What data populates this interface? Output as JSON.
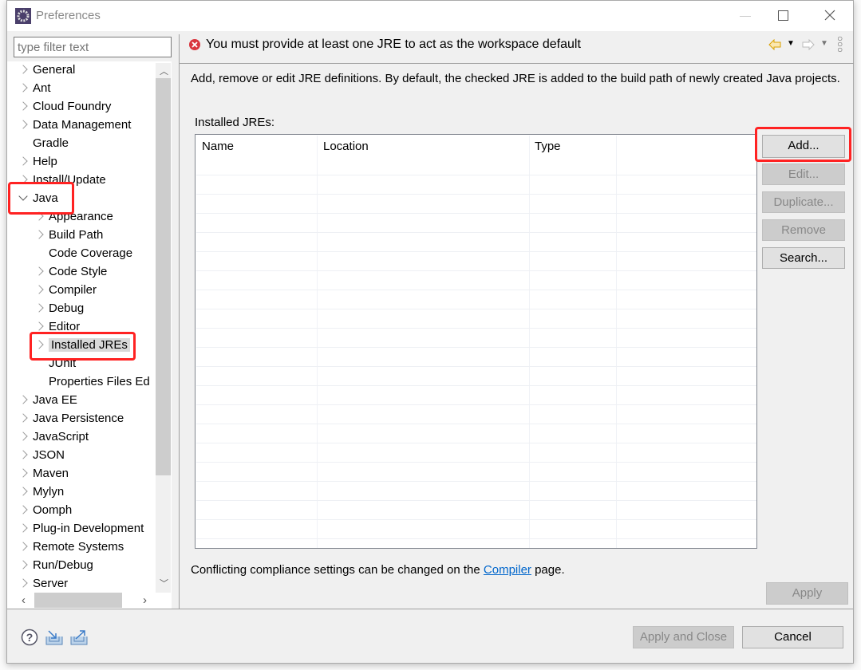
{
  "window": {
    "title": "Preferences"
  },
  "filter": {
    "placeholder": "type filter text"
  },
  "tree": [
    {
      "label": "General",
      "level": 0,
      "arrow": "right"
    },
    {
      "label": "Ant",
      "level": 0,
      "arrow": "right"
    },
    {
      "label": "Cloud Foundry",
      "level": 0,
      "arrow": "right"
    },
    {
      "label": "Data Management",
      "level": 0,
      "arrow": "right"
    },
    {
      "label": "Gradle",
      "level": 0,
      "arrow": "none"
    },
    {
      "label": "Help",
      "level": 0,
      "arrow": "right"
    },
    {
      "label": "Install/Update",
      "level": 0,
      "arrow": "right"
    },
    {
      "label": "Java",
      "level": 0,
      "arrow": "down"
    },
    {
      "label": "Appearance",
      "level": 1,
      "arrow": "right"
    },
    {
      "label": "Build Path",
      "level": 1,
      "arrow": "right"
    },
    {
      "label": "Code Coverage",
      "level": 1,
      "arrow": "none"
    },
    {
      "label": "Code Style",
      "level": 1,
      "arrow": "right"
    },
    {
      "label": "Compiler",
      "level": 1,
      "arrow": "right"
    },
    {
      "label": "Debug",
      "level": 1,
      "arrow": "right"
    },
    {
      "label": "Editor",
      "level": 1,
      "arrow": "right"
    },
    {
      "label": "Installed JREs",
      "level": 1,
      "arrow": "right",
      "selected": true
    },
    {
      "label": "JUnit",
      "level": 1,
      "arrow": "none"
    },
    {
      "label": "Properties Files Ed",
      "level": 1,
      "arrow": "none"
    },
    {
      "label": "Java EE",
      "level": 0,
      "arrow": "right"
    },
    {
      "label": "Java Persistence",
      "level": 0,
      "arrow": "right"
    },
    {
      "label": "JavaScript",
      "level": 0,
      "arrow": "right"
    },
    {
      "label": "JSON",
      "level": 0,
      "arrow": "right"
    },
    {
      "label": "Maven",
      "level": 0,
      "arrow": "right"
    },
    {
      "label": "Mylyn",
      "level": 0,
      "arrow": "right"
    },
    {
      "label": "Oomph",
      "level": 0,
      "arrow": "right"
    },
    {
      "label": "Plug-in Development",
      "level": 0,
      "arrow": "right"
    },
    {
      "label": "Remote Systems",
      "level": 0,
      "arrow": "right"
    },
    {
      "label": "Run/Debug",
      "level": 0,
      "arrow": "right"
    },
    {
      "label": "Server",
      "level": 0,
      "arrow": "right"
    }
  ],
  "page": {
    "error_message": "You must provide at least one JRE to act as the workspace default",
    "description": "Add, remove or edit JRE definitions. By default, the checked JRE is added to the build path of newly created Java projects.",
    "table_label": "Installed JREs:",
    "columns": [
      "Name",
      "Location",
      "Type"
    ],
    "rows": [],
    "buttons": {
      "add": "Add...",
      "edit": "Edit...",
      "duplicate": "Duplicate...",
      "remove": "Remove",
      "search": "Search..."
    },
    "footer_prefix": "Conflicting compliance settings can be changed on the ",
    "footer_link": "Compiler",
    "footer_suffix": " page.",
    "apply": "Apply"
  },
  "bottom": {
    "apply_close": "Apply and Close",
    "cancel": "Cancel"
  },
  "colors": {
    "annotation": "#ff2222",
    "link": "#0066cc",
    "error": "#d9363e"
  }
}
